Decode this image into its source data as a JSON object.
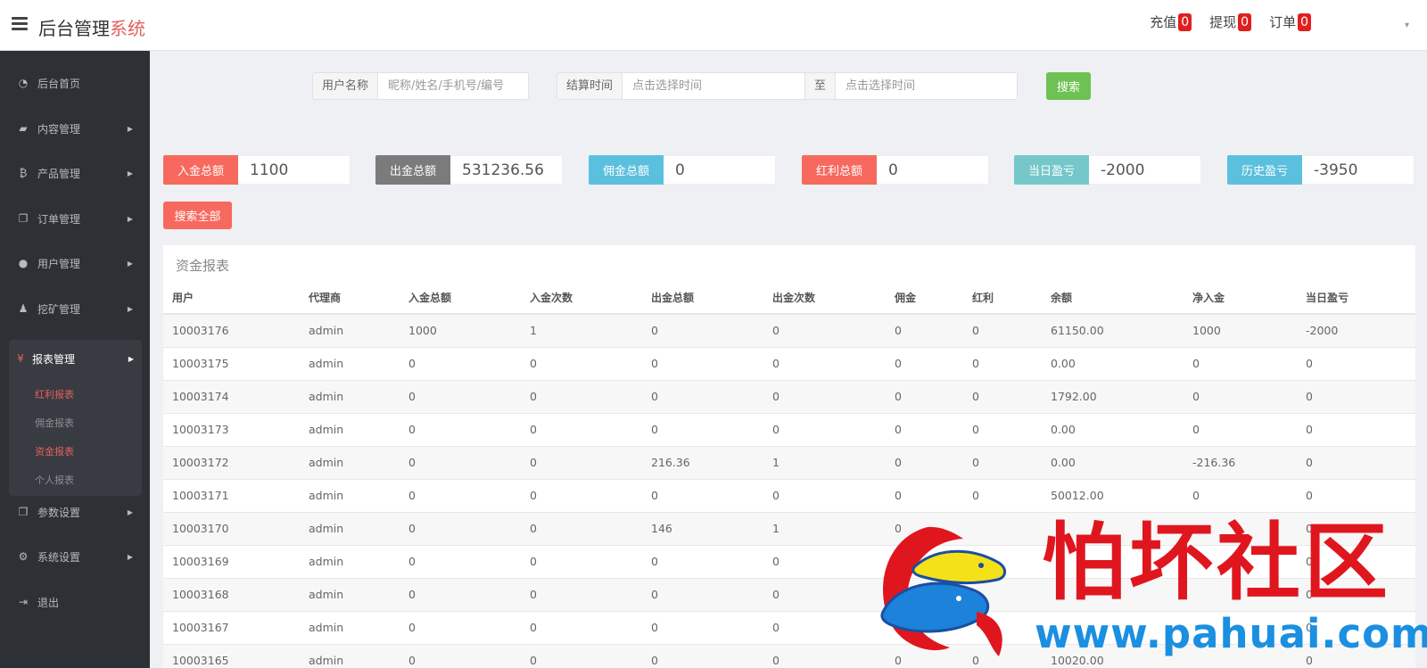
{
  "header": {
    "brand_main": "后台管理",
    "brand_accent": "系统",
    "links": [
      {
        "label": "充值",
        "count": "0"
      },
      {
        "label": "提现",
        "count": "0"
      },
      {
        "label": "订单",
        "count": "0"
      }
    ],
    "user_caret": "▾"
  },
  "sidebar": {
    "items": [
      {
        "label": "后台首页",
        "icon": "dashboard-icon"
      },
      {
        "label": "内容管理",
        "icon": "book-icon"
      },
      {
        "label": "产品管理",
        "icon": "bitcoin-icon"
      },
      {
        "label": "订单管理",
        "icon": "copy-icon"
      },
      {
        "label": "用户管理",
        "icon": "user-icon"
      },
      {
        "label": "挖矿管理",
        "icon": "user-tie-icon"
      },
      {
        "label": "报表管理",
        "icon": "yen-icon"
      },
      {
        "label": "参数设置",
        "icon": "copy-icon"
      },
      {
        "label": "系统设置",
        "icon": "cogs-icon"
      },
      {
        "label": "退出",
        "icon": "sign-out-icon"
      }
    ],
    "subitems": [
      {
        "label": "红利报表",
        "active": true
      },
      {
        "label": "佣金报表",
        "active": false
      },
      {
        "label": "资金报表",
        "active": true
      },
      {
        "label": "个人报表",
        "active": false
      }
    ]
  },
  "search": {
    "username_label": "用户名称",
    "username_placeholder": "昵称/姓名/手机号/编号",
    "time_label": "结算时间",
    "time_placeholder_start": "点击选择时间",
    "to_label": "至",
    "time_placeholder_end": "点击选择时间",
    "search_button": "搜索"
  },
  "stats": [
    {
      "label": "入金总额",
      "value": "1100",
      "color": "#f7695e"
    },
    {
      "label": "出金总额",
      "value": "531236.56",
      "color": "#7b7b7b"
    },
    {
      "label": "佣金总额",
      "value": "0",
      "color": "#5bc0de"
    },
    {
      "label": "红利总额",
      "value": "0",
      "color": "#f7695e"
    },
    {
      "label": "当日盈亏",
      "value": "-2000",
      "color": "#76c7c9"
    },
    {
      "label": "历史盈亏",
      "value": "-3950",
      "color": "#5bc0de"
    }
  ],
  "search_all_button": "搜索全部",
  "report": {
    "title": "资金报表",
    "columns": [
      "用户",
      "代理商",
      "入金总额",
      "入金次数",
      "出金总额",
      "出金次数",
      "佣金",
      "红利",
      "余额",
      "净入金",
      "当日盈亏"
    ],
    "rows": [
      [
        "10003176",
        "admin",
        "1000",
        "1",
        "0",
        "0",
        "0",
        "0",
        "61150.00",
        "1000",
        "-2000"
      ],
      [
        "10003175",
        "admin",
        "0",
        "0",
        "0",
        "0",
        "0",
        "0",
        "0.00",
        "0",
        "0"
      ],
      [
        "10003174",
        "admin",
        "0",
        "0",
        "0",
        "0",
        "0",
        "0",
        "1792.00",
        "0",
        "0"
      ],
      [
        "10003173",
        "admin",
        "0",
        "0",
        "0",
        "0",
        "0",
        "0",
        "0.00",
        "0",
        "0"
      ],
      [
        "10003172",
        "admin",
        "0",
        "0",
        "216.36",
        "1",
        "0",
        "0",
        "0.00",
        "-216.36",
        "0"
      ],
      [
        "10003171",
        "admin",
        "0",
        "0",
        "0",
        "0",
        "0",
        "0",
        "50012.00",
        "0",
        "0"
      ],
      [
        "10003170",
        "admin",
        "0",
        "0",
        "146",
        "1",
        "0",
        "",
        "",
        "",
        "0"
      ],
      [
        "10003169",
        "admin",
        "0",
        "0",
        "0",
        "0",
        "",
        "",
        "",
        "",
        "0"
      ],
      [
        "10003168",
        "admin",
        "0",
        "0",
        "0",
        "0",
        "",
        "",
        "",
        "",
        "0"
      ],
      [
        "10003167",
        "admin",
        "0",
        "0",
        "0",
        "0",
        "",
        "",
        "",
        "",
        "0"
      ],
      [
        "10003165",
        "admin",
        "0",
        "0",
        "0",
        "0",
        "0",
        "0",
        "10020.00",
        "",
        "0"
      ]
    ]
  },
  "watermark": {
    "text": "怕坏社区",
    "url": "www.pahuai.com"
  }
}
